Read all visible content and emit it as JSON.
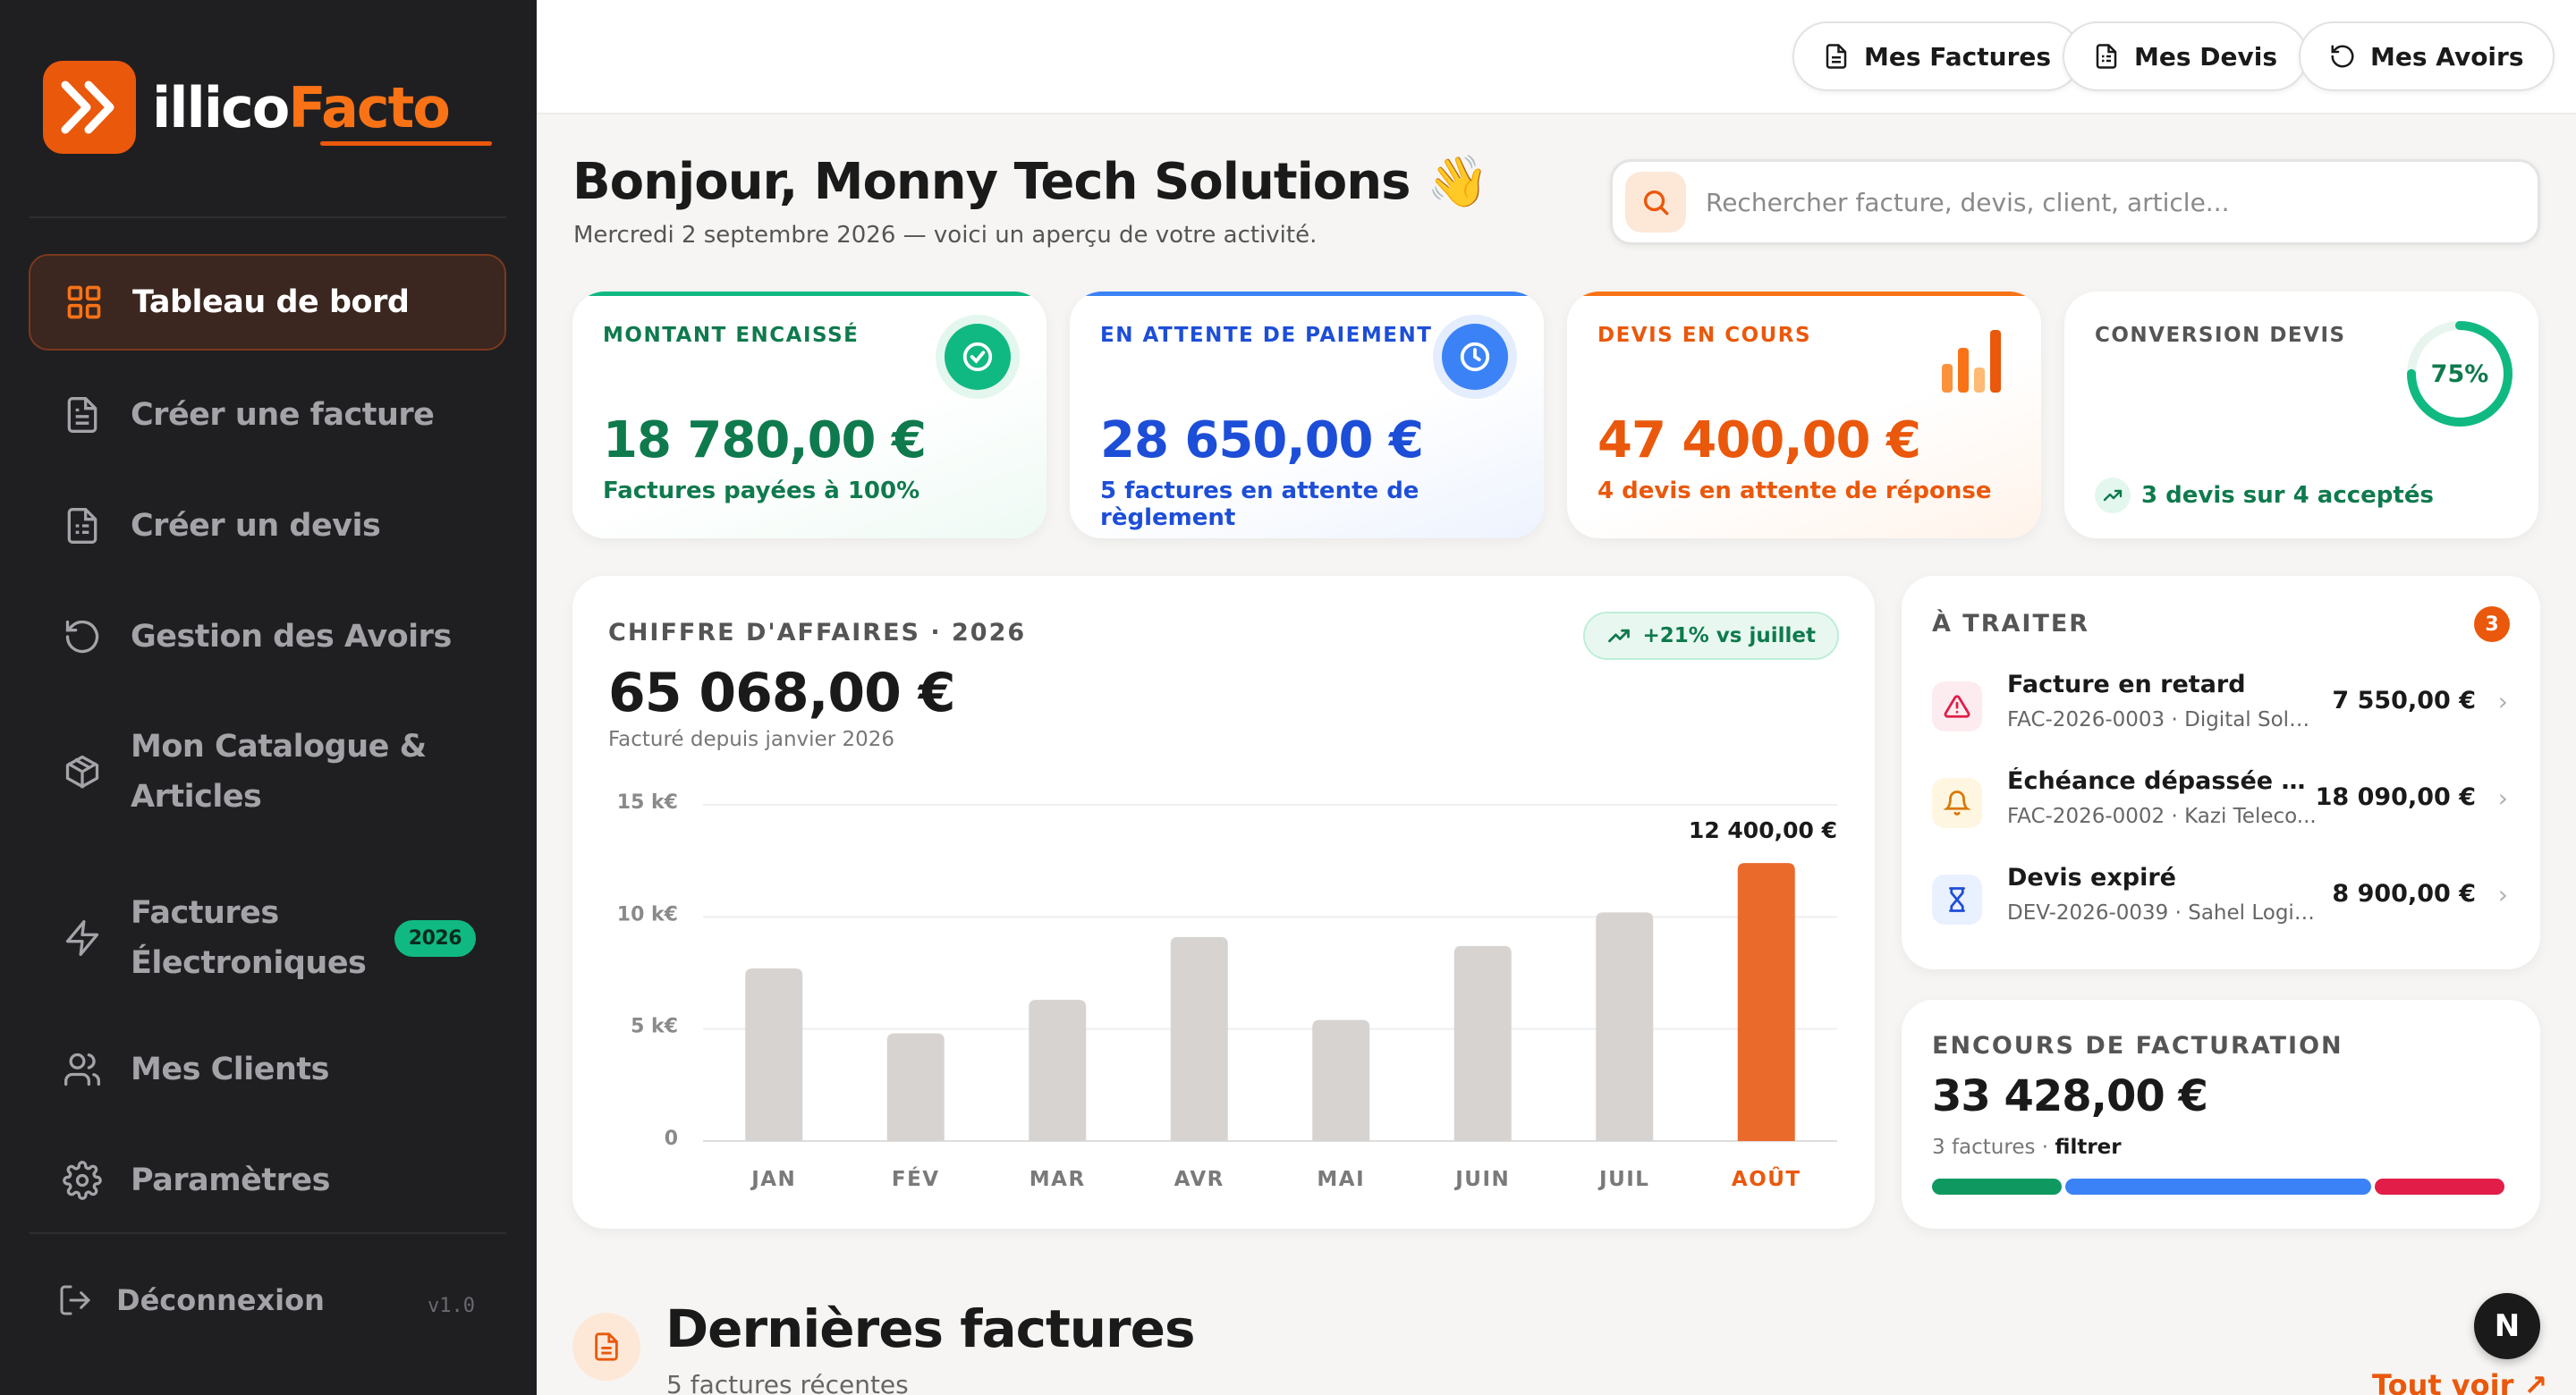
{
  "brand": {
    "name_part1": "illico",
    "name_part2": "Facto",
    "accent": "#ea580c"
  },
  "sidebar": {
    "items": [
      {
        "label": "Tableau de bord",
        "icon": "grid-icon",
        "active": true
      },
      {
        "label": "Créer une facture",
        "icon": "file-text-icon"
      },
      {
        "label": "Créer un devis",
        "icon": "file-list-icon"
      },
      {
        "label": "Gestion des Avoirs",
        "icon": "rotate-ccw-icon"
      },
      {
        "label": "Mon Catalogue & Articles",
        "icon": "package-icon"
      },
      {
        "label": "Factures Électroniques",
        "icon": "zap-icon",
        "badge": "2026"
      },
      {
        "label": "Mes Clients",
        "icon": "users-icon"
      },
      {
        "label": "Paramètres",
        "icon": "settings-icon"
      }
    ],
    "logout": "Déconnexion",
    "version": "v1.0"
  },
  "topbar": {
    "invoices": "Mes Factures",
    "quotes": "Mes Devis",
    "credits": "Mes Avoirs"
  },
  "header": {
    "greeting": "Bonjour, Monny Tech Solutions",
    "emoji": "👋",
    "date_line": "Mercredi 2 septembre 2026 — voici un aperçu de votre activité.",
    "search_placeholder": "Rechercher facture, devis, client, article..."
  },
  "kpis": [
    {
      "title": "MONTANT ENCAISSÉ",
      "value": "18 780,00 €",
      "sub": "Factures payées à 100%",
      "color": "#0f7a4d",
      "icon": "check-circle-icon"
    },
    {
      "title": "EN ATTENTE DE PAIEMENT",
      "value": "28 650,00 €",
      "sub": "5 factures en attente de règlement",
      "color": "#1d4ed8",
      "icon": "clock-icon"
    },
    {
      "title": "DEVIS EN COURS",
      "value": "47 400,00 €",
      "sub": "4 devis en attente de réponse",
      "color": "#ea580c",
      "icon": "bar-chart-icon"
    },
    {
      "title": "CONVERSION DEVIS",
      "value_pct": "75%",
      "percent": 75,
      "sub": "3 devis sur 4 acceptés",
      "color": "#0f7a4d",
      "icon": "trending-up-icon"
    }
  ],
  "revenue": {
    "title": "CHIFFRE D'AFFAIRES · 2026",
    "value": "65 068,00 €",
    "sub": "Facturé depuis janvier 2026",
    "trend": "+21% vs juillet",
    "highlight_label": "12 400,00 €"
  },
  "chart_data": {
    "type": "bar",
    "categories": [
      "JAN",
      "FÉV",
      "MAR",
      "AVR",
      "MAI",
      "JUIN",
      "JUIL",
      "AOÛT"
    ],
    "values": [
      7700,
      4800,
      6300,
      9100,
      5400,
      8700,
      10200,
      12400
    ],
    "yticks": [
      "15 k€",
      "10 k€",
      "5 k€",
      "0"
    ],
    "ylim": [
      0,
      15000
    ],
    "highlight_index": 7,
    "bar_color": "#d6d3d1",
    "highlight_color": "#ea6a2c",
    "grid": true
  },
  "todo": {
    "title": "À TRAITER",
    "count": "3",
    "items": [
      {
        "title": "Facture en retard",
        "sub": "FAC-2026-0003 · Digital Solut...",
        "amount": "7 550,00 €",
        "icon": "alert-triangle-icon"
      },
      {
        "title": "Échéance dépassée — ...",
        "sub": "FAC-2026-0002 · Kazi Teleco...",
        "amount": "18 090,00 €",
        "icon": "bell-icon"
      },
      {
        "title": "Devis expiré",
        "sub": "DEV-2026-0039 · Sahel Logist...",
        "amount": "8 900,00 €",
        "icon": "hourglass-icon"
      }
    ]
  },
  "outstanding": {
    "title": "ENCOURS DE FACTURATION",
    "value": "33 428,00 €",
    "sub_count": "3 factures · ",
    "sub_filter": "filtrer",
    "segments": [
      {
        "share": 0.23,
        "color": "#0f9960"
      },
      {
        "share": 0.54,
        "color": "#3b82f6"
      },
      {
        "share": 0.23,
        "color": "#e11d48"
      }
    ]
  },
  "latest": {
    "title": "Dernières factures",
    "sub": "5 factures récentes",
    "see_all": "Tout voir ↗"
  },
  "fab": "N"
}
